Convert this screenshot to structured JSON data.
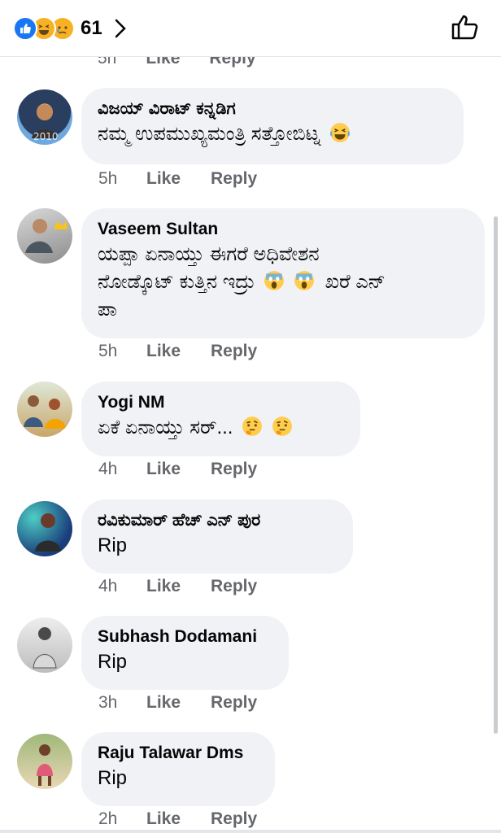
{
  "header": {
    "reaction_count": "61",
    "reactions": [
      "like-icon",
      "haha-icon",
      "sad-icon"
    ]
  },
  "clipped_meta": {
    "time": "5h",
    "like": "Like",
    "reply": "Reply"
  },
  "comments": [
    {
      "name": "ವಿಜಯ್ ವಿರಾಟ್ ಕನ್ನಡಿಗ",
      "lines": [
        "ನಮ್ಮ ಉಪಮುಖ್ಯಮಂತ್ರಿ ಸತ್ತೋಬಿಟ್ನ"
      ],
      "emojis": [
        "laughing-emoji"
      ],
      "time": "5h",
      "like": "Like",
      "reply": "Reply"
    },
    {
      "name": "Vaseem Sultan",
      "lines": [
        "ಯಪ್ಪಾ ಏನಾಯ್ತು ಈಗರೆ ಅಧಿವೇಶನ",
        "ನೋಡ್ಕೊಟ್ ಕುತ್ತಿನ ಇದ್ರು",
        "ಪಾ"
      ],
      "line2_tail": "ಖರೆ ಎನ್",
      "emojis": [
        "screaming-emoji",
        "screaming-emoji"
      ],
      "time": "5h",
      "like": "Like",
      "reply": "Reply"
    },
    {
      "name": "Yogi NM",
      "lines": [
        "ಏಕೆ ಏನಾಯ್ತು ಸರ್..."
      ],
      "emojis": [
        "thinking-emoji",
        "thinking-emoji"
      ],
      "time": "4h",
      "like": "Like",
      "reply": "Reply"
    },
    {
      "name": "ರವಿಕುಮಾರ್ ಹೆಚ್ ಎನ್ ಪುರ",
      "lines": [
        "Rip"
      ],
      "time": "4h",
      "like": "Like",
      "reply": "Reply"
    },
    {
      "name": "Subhash Dodamani",
      "lines": [
        "Rip"
      ],
      "time": "3h",
      "like": "Like",
      "reply": "Reply"
    },
    {
      "name": "Raju Talawar Dms",
      "lines": [
        "Rip"
      ],
      "time": "2h",
      "like": "Like",
      "reply": "Reply"
    }
  ],
  "colors": {
    "accent": "#1877f2",
    "bubble": "#f0f2f5",
    "meta": "#65676b"
  }
}
